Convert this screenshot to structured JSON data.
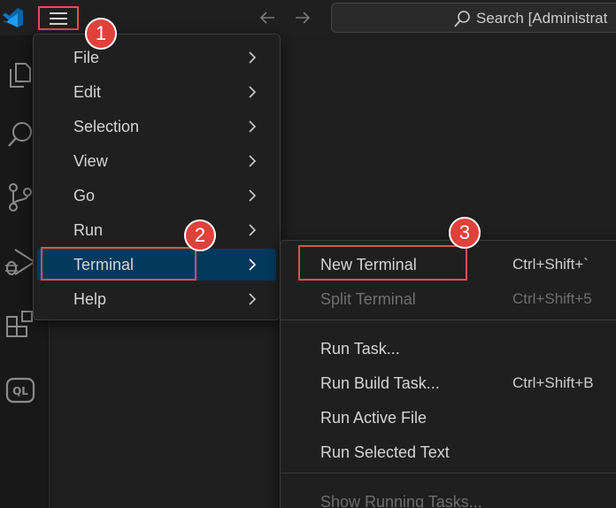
{
  "titlebar": {
    "search_text": "Search [Administrat"
  },
  "menu": {
    "items": [
      {
        "label": "File"
      },
      {
        "label": "Edit"
      },
      {
        "label": "Selection"
      },
      {
        "label": "View"
      },
      {
        "label": "Go"
      },
      {
        "label": "Run"
      },
      {
        "label": "Terminal"
      },
      {
        "label": "Help"
      }
    ]
  },
  "submenu": {
    "items": [
      {
        "label": "New Terminal",
        "shortcut": "Ctrl+Shift+`"
      },
      {
        "label": "Split Terminal",
        "shortcut": "Ctrl+Shift+5"
      },
      {
        "label": "Run Task..."
      },
      {
        "label": "Run Build Task...",
        "shortcut": "Ctrl+Shift+B"
      },
      {
        "label": "Run Active File"
      },
      {
        "label": "Run Selected Text"
      },
      {
        "label": "Show Running Tasks..."
      }
    ]
  },
  "badges": {
    "b1": "1",
    "b2": "2",
    "b3": "3"
  },
  "colors": {
    "accent": "#007acc",
    "highlight": "#04395e",
    "annotation": "#e0413a"
  },
  "icons": [
    "vscode-logo-icon",
    "menu-icon",
    "arrow-left-icon",
    "arrow-right-icon",
    "search-icon",
    "explorer-icon",
    "search-view-icon",
    "source-control-icon",
    "run-debug-icon",
    "extensions-icon",
    "ql-icon",
    "chevron-right-icon"
  ]
}
